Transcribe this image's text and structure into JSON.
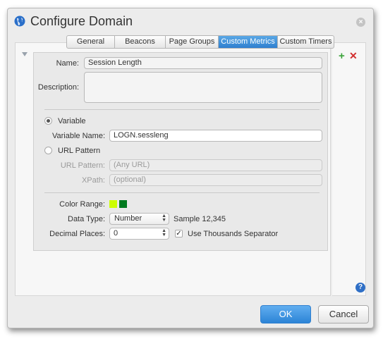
{
  "window": {
    "title": "Configure Domain"
  },
  "tabs": [
    {
      "label": "General"
    },
    {
      "label": "Beacons"
    },
    {
      "label": "Page Groups"
    },
    {
      "label": "Custom Metrics"
    },
    {
      "label": "Custom Timers"
    }
  ],
  "active_tab": "Custom Metrics",
  "form": {
    "name_label": "Name:",
    "name_value": "Session Length",
    "description_label": "Description:",
    "description_value": "",
    "variable_radio_label": "Variable",
    "variable_name_label": "Variable Name:",
    "variable_name_value": "LOGN.sessleng",
    "url_pattern_radio_label": "URL Pattern",
    "url_pattern_label": "URL Pattern:",
    "url_pattern_placeholder": "(Any URL)",
    "xpath_label": "XPath:",
    "xpath_placeholder": "(optional)",
    "color_range_label": "Color Range:",
    "color_range_colors": [
      "#ccff00",
      "#007a1f"
    ],
    "data_type_label": "Data Type:",
    "data_type_value": "Number",
    "sample_text": "Sample 12,345",
    "decimal_places_label": "Decimal Places:",
    "decimal_places_value": "0",
    "thousands_separator_label": "Use Thousands Separator",
    "thousands_separator_checked": true,
    "selected_source": "Variable"
  },
  "buttons": {
    "ok": "OK",
    "cancel": "Cancel"
  },
  "icons": {
    "title_icon": "globe-icon",
    "close": "close-icon",
    "add": "plus-icon",
    "delete": "x-icon",
    "help": "question-icon",
    "collapse": "triangle-down-icon"
  },
  "colors": {
    "accent": "#2f7fcf",
    "add_green": "#3aa33a",
    "delete_red": "#d22f2f"
  }
}
